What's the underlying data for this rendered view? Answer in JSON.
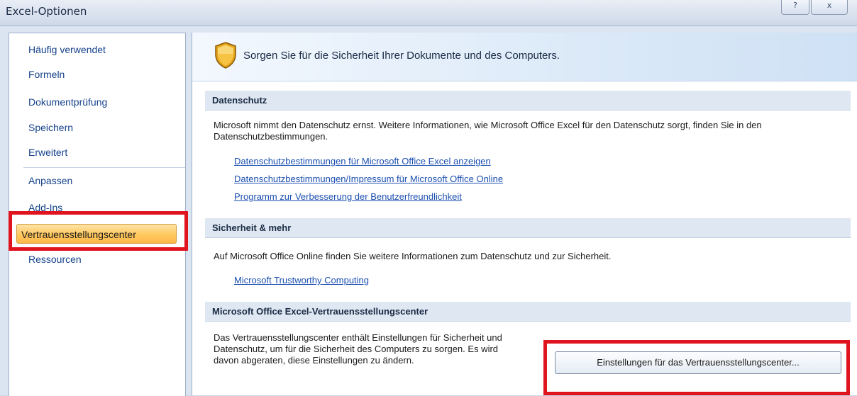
{
  "window": {
    "title": "Excel-Optionen",
    "help_label": "?",
    "close_label": "x"
  },
  "sidebar": {
    "items": [
      {
        "label": "Häufig verwendet"
      },
      {
        "label": "Formeln"
      },
      {
        "label": "Dokumentprüfung"
      },
      {
        "label": "Speichern"
      },
      {
        "label": "Erweitert"
      },
      {
        "label": "Anpassen"
      },
      {
        "label": "Add-Ins"
      },
      {
        "label": "Vertrauensstellungscenter",
        "selected": true
      },
      {
        "label": "Ressourcen"
      }
    ]
  },
  "banner": {
    "icon": "shield-icon",
    "text": "Sorgen Sie für die Sicherheit Ihrer Dokumente und des Computers."
  },
  "sections": {
    "privacy": {
      "header": "Datenschutz",
      "text": "Microsoft nimmt den Datenschutz ernst. Weitere Informationen, wie Microsoft Office Excel für den Datenschutz sorgt, finden Sie in den Datenschutzbestimmungen.",
      "links": [
        "Datenschutzbestimmungen für Microsoft Office Excel anzeigen",
        "Datenschutzbestimmungen/Impressum für Microsoft Office Online",
        "Programm zur Verbesserung der Benutzerfreundlichkeit"
      ]
    },
    "security": {
      "header": "Sicherheit & mehr",
      "text": "Auf Microsoft Office Online finden Sie weitere Informationen zum Datenschutz und zur Sicherheit.",
      "link": "Microsoft Trustworthy Computing"
    },
    "trust_center": {
      "header": "Microsoft Office Excel-Vertrauensstellungscenter",
      "text": "Das Vertrauensstellungscenter enthält Einstellungen für Sicherheit und Datenschutz, um für die Sicherheit des Computers zu sorgen. Es wird davon abgeraten, diese Einstellungen zu ändern.",
      "button": "Einstellungen für das Vertrauensstellungscenter..."
    }
  },
  "colors": {
    "highlight": "#e0141e",
    "link": "#1b4fb0",
    "selected_bg": "#ffc85e"
  }
}
